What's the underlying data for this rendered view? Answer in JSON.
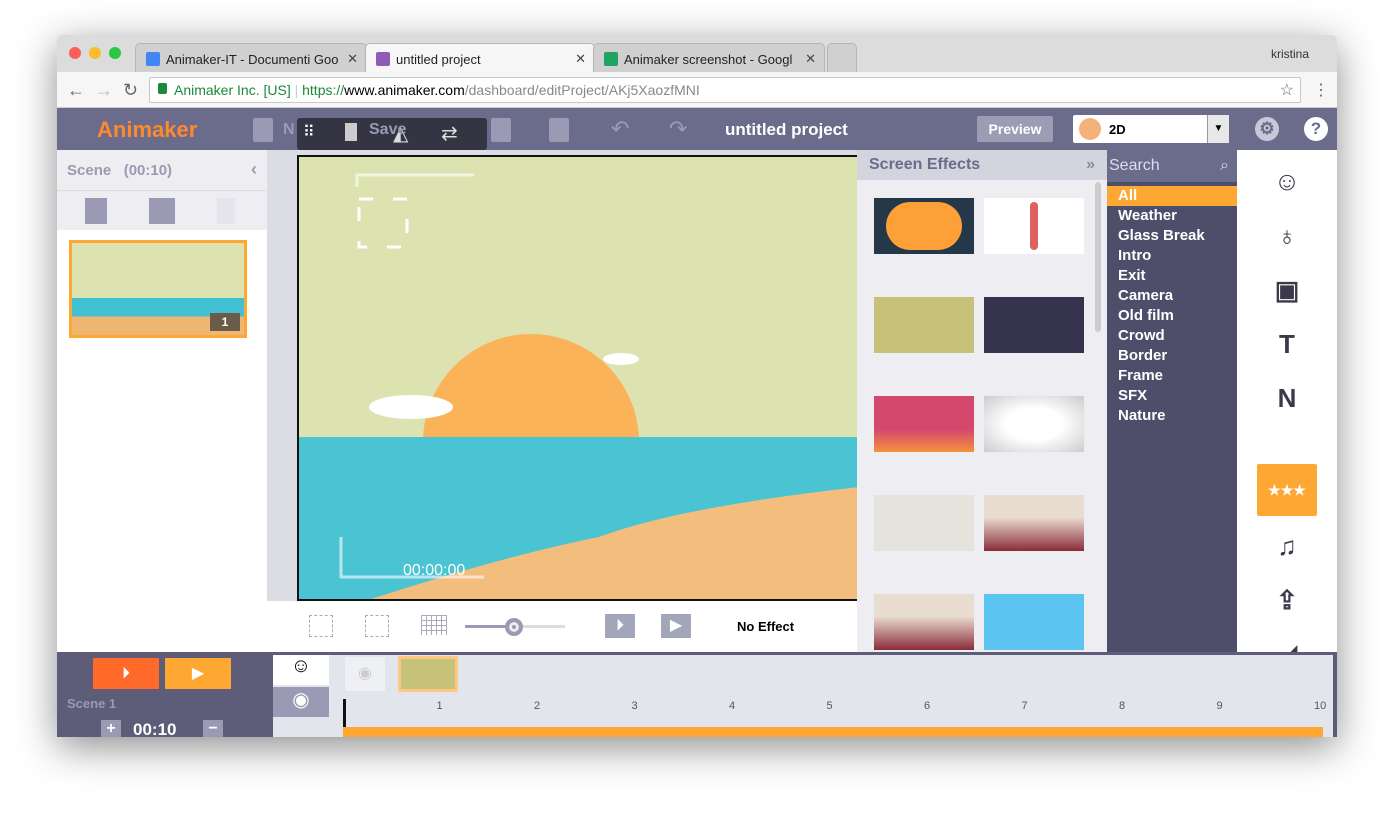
{
  "browser": {
    "tabs": [
      {
        "title": "Animaker-IT - Documenti Goo",
        "icon": "docs-icon",
        "color": "#4285f4"
      },
      {
        "title": "untitled project",
        "icon": "animaker-icon",
        "color": "#8e5bb5",
        "active": true
      },
      {
        "title": "Animaker screenshot - Googl",
        "icon": "drive-icon",
        "color": "#1fa463"
      }
    ],
    "user": "kristina",
    "url_secure": "Animaker Inc. [US]",
    "url_scheme": "https://",
    "url_host": "www.animaker.com",
    "url_path": "/dashboard/editProject/AKj5XaozfMNI"
  },
  "toolbar": {
    "logo": "Animaker",
    "new_label": "N",
    "save_label": "Save",
    "project_title": "untitled project",
    "preview_label": "Preview",
    "mode": "2D"
  },
  "scenes": {
    "header": "Scene   (00:10)",
    "items": [
      {
        "number": "1"
      }
    ]
  },
  "stage": {
    "timecode": "00:00:00",
    "effect_label": "No Effect",
    "zoom_percent": 50
  },
  "effects": {
    "title": "Screen Effects",
    "search_placeholder": "Search",
    "categories": [
      "All",
      "Weather",
      "Glass Break",
      "Intro",
      "Exit",
      "Camera",
      "Old film",
      "Crowd",
      "Border",
      "Frame",
      "SFX",
      "Nature"
    ],
    "selected": "All"
  },
  "right_bar": [
    "character-icon",
    "lightbulb-icon",
    "image-icon",
    "T",
    "N",
    "effects-icon",
    "music-icon",
    "upload-icon",
    "background-icon"
  ],
  "timeline": {
    "scene_label": "Scene 1",
    "duration": "00:10",
    "ticks": [
      "1",
      "2",
      "3",
      "4",
      "5",
      "6",
      "7",
      "8",
      "9",
      "10"
    ]
  },
  "colors": {
    "accent": "#ffa733",
    "toolbar": "#6b6b8c",
    "play_orange": "#ff6a2b"
  }
}
